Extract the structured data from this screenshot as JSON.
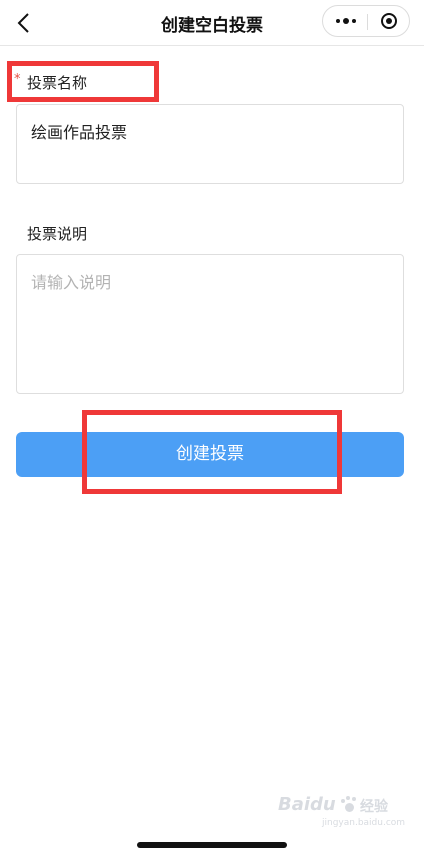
{
  "navbar": {
    "title": "创建空白投票",
    "back_icon": "chevron-left-icon",
    "more_icon": "more-dots-icon",
    "close_icon": "target-circle-icon"
  },
  "form": {
    "name": {
      "required_mark": "*",
      "label": "投票名称",
      "value": "绘画作品投票"
    },
    "description": {
      "label": "投票说明",
      "placeholder": "请输入说明",
      "value": ""
    },
    "submit_label": "创建投票"
  },
  "watermark": {
    "logo": "Baidu",
    "subtitle": "经验",
    "url": "jingyan.baidu.com"
  },
  "colors": {
    "primary_button": "#4c9ff5",
    "required_star": "#e54d42",
    "highlight_box": "#ef3838",
    "placeholder": "#b3b3b3"
  }
}
